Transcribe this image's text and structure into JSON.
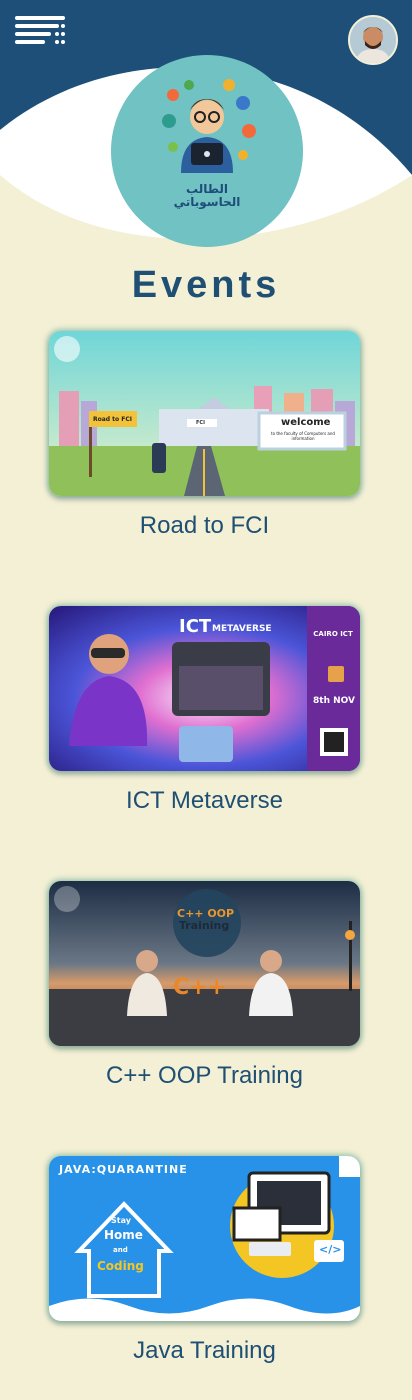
{
  "header": {
    "logo_text_line1": "الطالب",
    "logo_text_line2": "الحاسوباتي"
  },
  "page": {
    "title": "Events"
  },
  "events": [
    {
      "title": "Road to FCI",
      "sign_text": "Road to FCI",
      "billboard_title": "welcome",
      "billboard_sub": "to the faculty of Computers and information",
      "building_label": "FCI"
    },
    {
      "title": "ICT Metaverse",
      "banner": "ICT",
      "banner_sub": "METAVERSE",
      "side_brand": "CAIRO ICT",
      "date": "8th NOV"
    },
    {
      "title": "C++ OOP Training",
      "badge_line1": "C++ OOP",
      "badge_line2": "Training",
      "big_text": "C++"
    },
    {
      "title": "Java Training",
      "banner": "JAVA:QUARANTINE",
      "line1": "Stay",
      "line2": "Home",
      "line3": "and",
      "line4": "Coding",
      "code_tag": "</>"
    }
  ]
}
